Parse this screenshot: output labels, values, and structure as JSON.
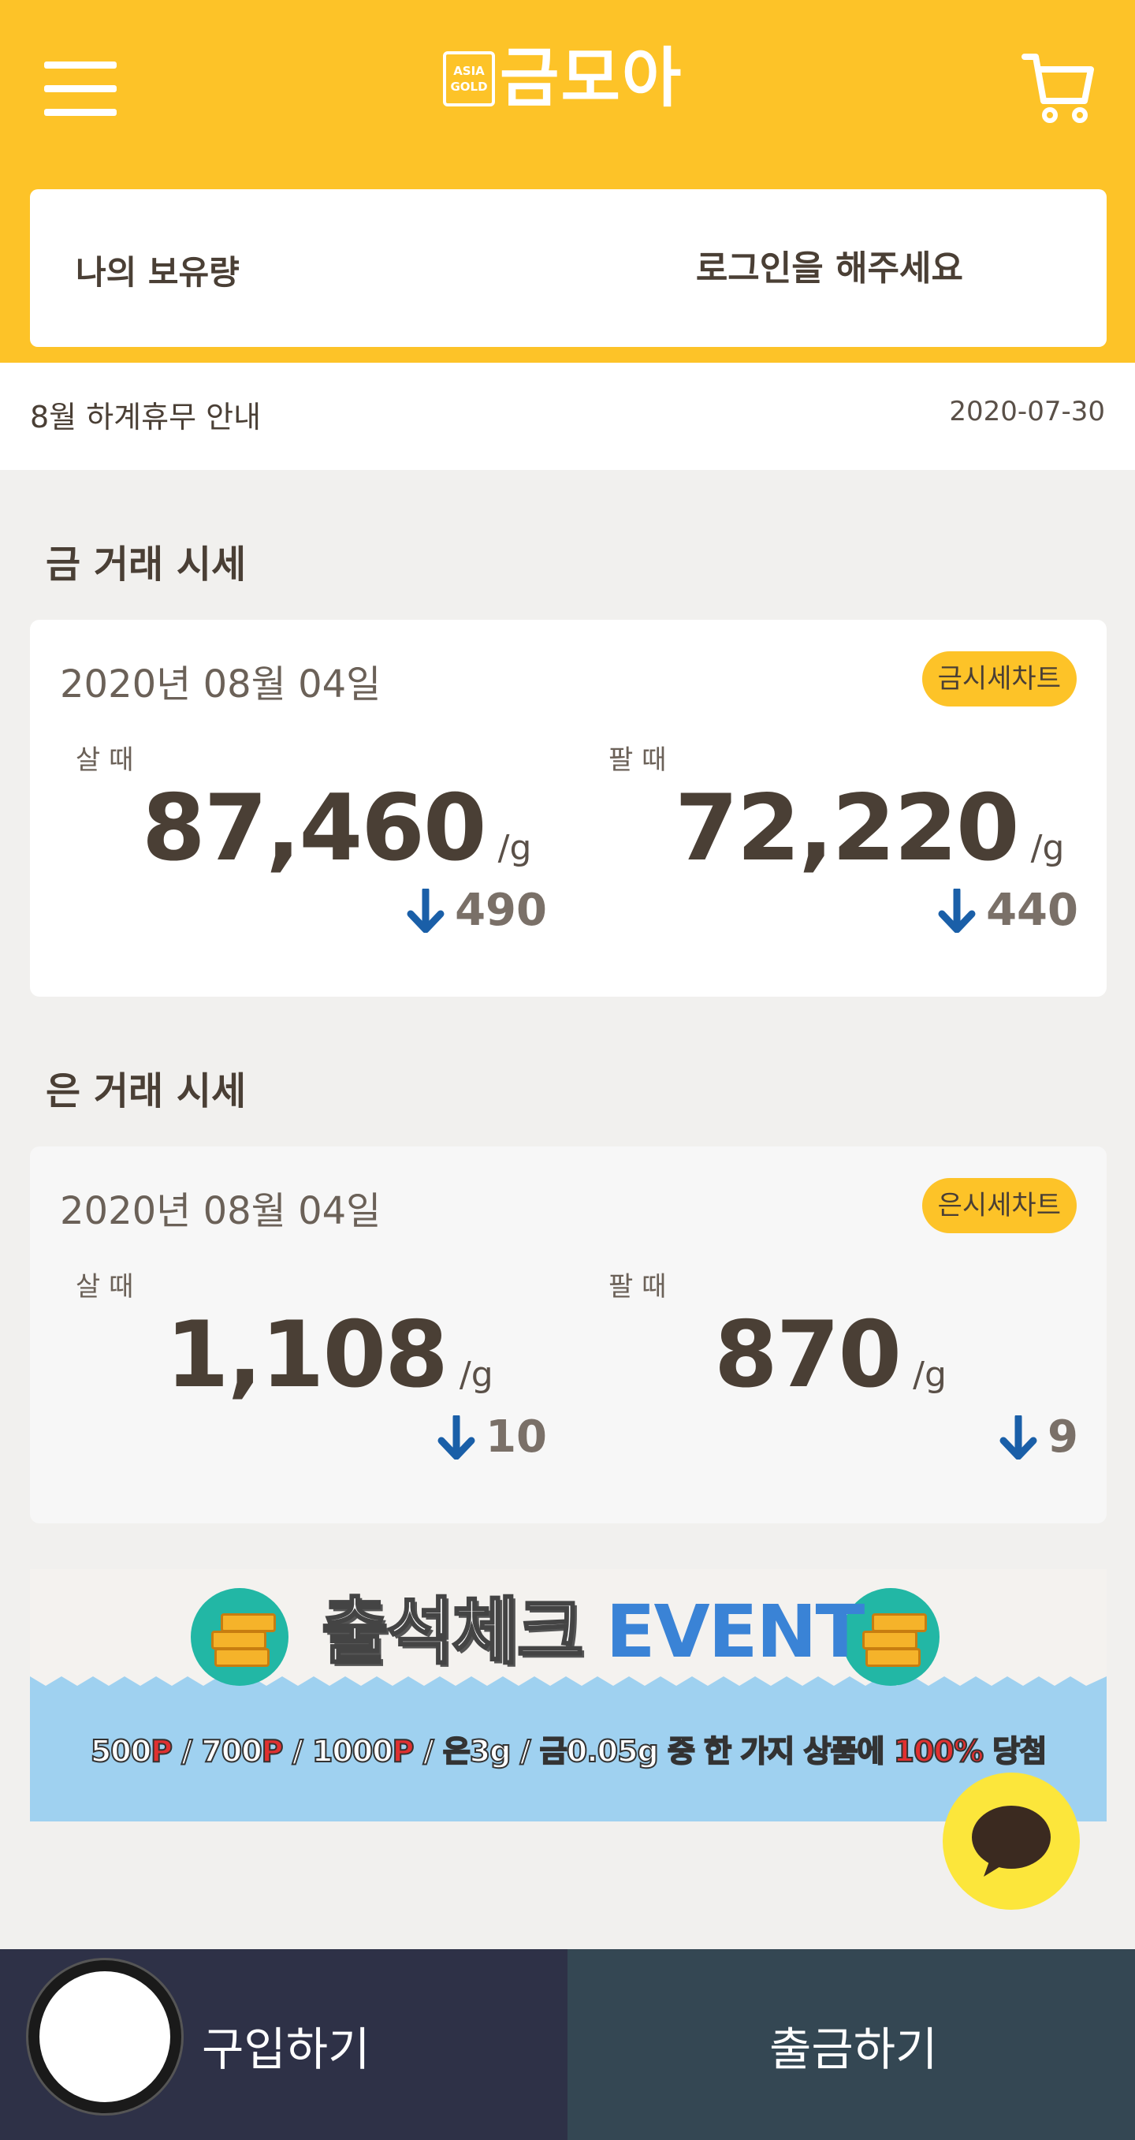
{
  "header": {
    "logo_badge_line1": "ASIA",
    "logo_badge_line2": "GOLD",
    "logo_text": "금모아",
    "menu_icon": "hamburger-menu-icon",
    "cart_icon": "shopping-cart-icon",
    "background_color": "#fdc328"
  },
  "holding": {
    "label": "나의 보유량",
    "login_prompt": "로그인을 해주세요"
  },
  "notice": {
    "title": "8월 하계휴무 안내",
    "date": "2020-07-30"
  },
  "gold": {
    "section_title": "금 거래 시세",
    "date": "2020년 08월 04일",
    "chart_button": "금시세차트",
    "buy": {
      "label": "살 때",
      "price": "87,460",
      "unit": "/g",
      "change": "490",
      "direction": "down"
    },
    "sell": {
      "label": "팔 때",
      "price": "72,220",
      "unit": "/g",
      "change": "440",
      "direction": "down"
    }
  },
  "silver": {
    "section_title": "은 거래 시세",
    "date": "2020년 08월 04일",
    "chart_button": "은시세차트",
    "buy": {
      "label": "살 때",
      "price": "1,108",
      "unit": "/g",
      "change": "10",
      "direction": "down"
    },
    "sell": {
      "label": "팔 때",
      "price": "870",
      "unit": "/g",
      "change": "9",
      "direction": "down"
    }
  },
  "banner": {
    "title_kr": "출석체크",
    "title_en": "EVENT",
    "sub_p1": "500",
    "sub_p2": "700",
    "sub_p3": "1000",
    "sub_p_mark": "P",
    "sub_silver": "은3g",
    "sub_gold_char": "금",
    "sub_gold_amount": "0.05g",
    "sub_rest": "중 한 가지 상품에",
    "sub_percent": "100%",
    "sub_win": "당첨"
  },
  "chat_icon": "kakao-chat-icon",
  "bottom": {
    "buy_label": "구입하기",
    "withdraw_label": "출금하기"
  },
  "colors": {
    "accent": "#fdc328",
    "arrow_down": "#1a5fa8",
    "buy_bar": "#2e3147",
    "withdraw_bar": "#344753"
  }
}
